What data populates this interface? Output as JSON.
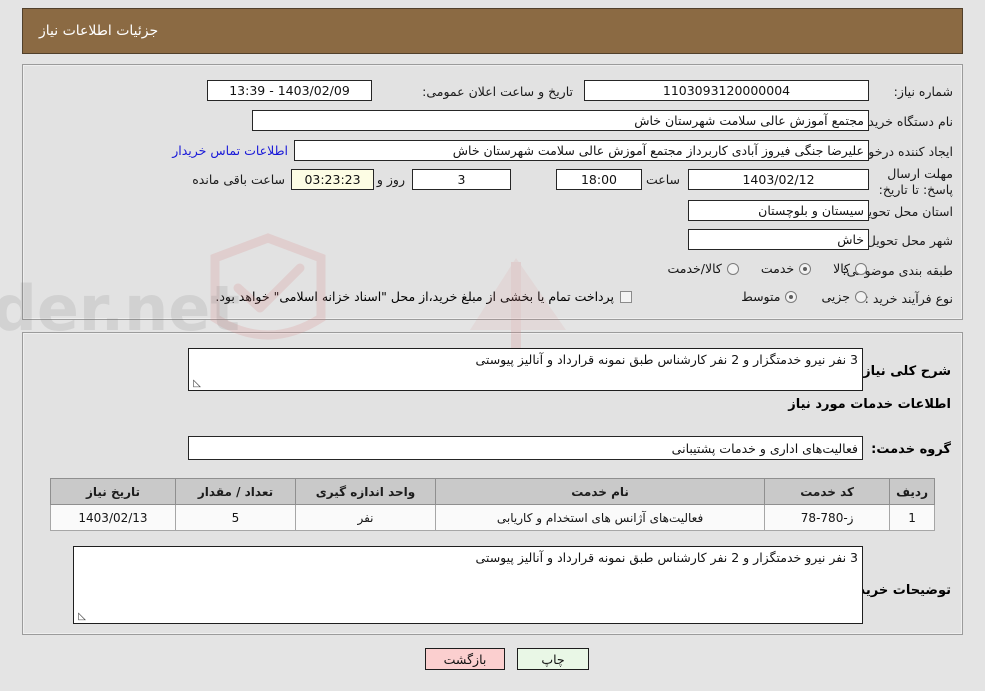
{
  "header": {
    "title": "جزئیات اطلاعات نیاز"
  },
  "form": {
    "need_number": {
      "label": "شماره نیاز:",
      "value": "1103093120000004"
    },
    "announce_datetime": {
      "label": "تاریخ و ساعت اعلان عمومی:",
      "value": "1403/02/09 - 13:39"
    },
    "buyer_org": {
      "label": "نام دستگاه خریدار:",
      "value": "مجتمع آموزش عالی سلامت شهرستان خاش"
    },
    "creator": {
      "label": "ایجاد کننده درخواست:",
      "value": "علیرضا جنگی فیروز آبادی کاربرداز مجتمع آموزش عالی سلامت شهرستان خاش"
    },
    "contact_link": "اطلاعات تماس خریدار",
    "deadline": {
      "label": "مهلت ارسال پاسخ: تا تاریخ:",
      "date": "1403/02/12",
      "hour_label": "ساعت",
      "hour": "18:00",
      "days": "3",
      "days_label": "روز و",
      "countdown": "03:23:23",
      "countdown_label": "ساعت باقی مانده"
    },
    "province": {
      "label": "استان محل تحویل:",
      "value": "سیستان و بلوچستان"
    },
    "city": {
      "label": "شهر محل تحویل:",
      "value": "خاش"
    },
    "category": {
      "label": "طبقه بندی موضوعی:",
      "options": [
        {
          "label": "کالا",
          "selected": false
        },
        {
          "label": "خدمت",
          "selected": true
        },
        {
          "label": "کالا/خدمت",
          "selected": false
        }
      ]
    },
    "purchase_type": {
      "label": "نوع فرآیند خرید :",
      "options": [
        {
          "label": "جزیی",
          "selected": false
        },
        {
          "label": "متوسط",
          "selected": true
        }
      ],
      "checkbox_label": "پرداخت تمام یا بخشی از مبلغ خرید،از محل \"اسناد خزانه اسلامی\" خواهد بود.",
      "checkbox_checked": false
    }
  },
  "need_desc": {
    "label": "شرح کلی نیاز:",
    "value": "3 نفر نیرو خدمتگزار و 2 نفر کارشناس طبق نمونه قرارداد و آنالیز پیوستی"
  },
  "services_heading": "اطلاعات خدمات مورد نیاز",
  "service_group": {
    "label": "گروه خدمت:",
    "value": "فعالیت‌های اداری و خدمات پشتیبانی"
  },
  "items_table": {
    "headers": [
      "ردیف",
      "کد خدمت",
      "نام خدمت",
      "واحد اندازه گیری",
      "تعداد / مقدار",
      "تاریخ نیاز"
    ],
    "rows": [
      {
        "row": "1",
        "code": "ز-780-78",
        "name": "فعالیت‌های آژانس های استخدام و کاریابی",
        "unit": "نفر",
        "quantity": "5",
        "need_date": "1403/02/13"
      }
    ]
  },
  "buyer_notes": {
    "label": "توضیحات خریدار:",
    "value": "3 نفر نیرو خدمتگزار و 2 نفر کارشناس طبق نمونه قرارداد و آنالیز پیوستی"
  },
  "footer": {
    "print_label": "چاپ",
    "back_label": "بازگشت"
  },
  "watermark": {
    "text": "AriaTender.net"
  },
  "colors": {
    "header_bg": "#8b6a43",
    "panel_bg": "#e2e2e2",
    "page_bg": "#e4e4e4",
    "link": "#1818d8",
    "back_btn": "#fbcfcf",
    "print_btn": "#e9f7e6",
    "countdown_bg": "#fdfde4"
  }
}
